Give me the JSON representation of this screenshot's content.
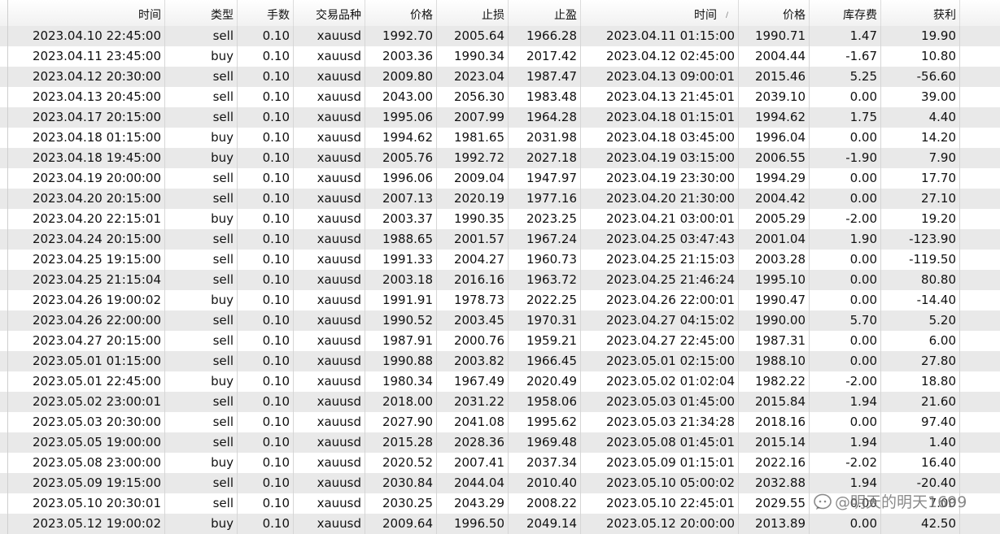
{
  "headers": [
    "时间",
    "类型",
    "手数",
    "交易品种",
    "价格",
    "止损",
    "止盈",
    "时间",
    "价格",
    "库存费",
    "获利"
  ],
  "sort_indicator": "∕",
  "rows": [
    [
      "2023.04.10 22:45:00",
      "sell",
      "0.10",
      "xauusd",
      "1992.70",
      "2005.64",
      "1966.28",
      "2023.04.11 01:15:00",
      "1990.71",
      "1.47",
      "19.90"
    ],
    [
      "2023.04.11 23:45:00",
      "buy",
      "0.10",
      "xauusd",
      "2003.36",
      "1990.34",
      "2017.42",
      "2023.04.12 02:45:00",
      "2004.44",
      "-1.67",
      "10.80"
    ],
    [
      "2023.04.12 20:30:00",
      "sell",
      "0.10",
      "xauusd",
      "2009.80",
      "2023.04",
      "1987.47",
      "2023.04.13 09:00:01",
      "2015.46",
      "5.25",
      "-56.60"
    ],
    [
      "2023.04.13 20:45:00",
      "sell",
      "0.10",
      "xauusd",
      "2043.00",
      "2056.30",
      "1983.48",
      "2023.04.13 21:45:01",
      "2039.10",
      "0.00",
      "39.00"
    ],
    [
      "2023.04.17 20:15:00",
      "sell",
      "0.10",
      "xauusd",
      "1995.06",
      "2007.99",
      "1964.28",
      "2023.04.18 01:15:01",
      "1994.62",
      "1.75",
      "4.40"
    ],
    [
      "2023.04.18 01:15:00",
      "buy",
      "0.10",
      "xauusd",
      "1994.62",
      "1981.65",
      "2031.98",
      "2023.04.18 03:45:00",
      "1996.04",
      "0.00",
      "14.20"
    ],
    [
      "2023.04.18 19:45:00",
      "buy",
      "0.10",
      "xauusd",
      "2005.76",
      "1992.72",
      "2027.18",
      "2023.04.19 03:15:00",
      "2006.55",
      "-1.90",
      "7.90"
    ],
    [
      "2023.04.19 20:00:00",
      "sell",
      "0.10",
      "xauusd",
      "1996.06",
      "2009.04",
      "1947.97",
      "2023.04.19 23:30:00",
      "1994.29",
      "0.00",
      "17.70"
    ],
    [
      "2023.04.20 20:15:00",
      "sell",
      "0.10",
      "xauusd",
      "2007.13",
      "2020.19",
      "1977.16",
      "2023.04.20 21:30:00",
      "2004.42",
      "0.00",
      "27.10"
    ],
    [
      "2023.04.20 22:15:01",
      "buy",
      "0.10",
      "xauusd",
      "2003.37",
      "1990.35",
      "2023.25",
      "2023.04.21 03:00:01",
      "2005.29",
      "-2.00",
      "19.20"
    ],
    [
      "2023.04.24 20:15:00",
      "sell",
      "0.10",
      "xauusd",
      "1988.65",
      "2001.57",
      "1967.24",
      "2023.04.25 03:47:43",
      "2001.04",
      "1.90",
      "-123.90"
    ],
    [
      "2023.04.25 19:15:00",
      "sell",
      "0.10",
      "xauusd",
      "1991.33",
      "2004.27",
      "1960.73",
      "2023.04.25 21:15:03",
      "2003.28",
      "0.00",
      "-119.50"
    ],
    [
      "2023.04.25 21:15:04",
      "sell",
      "0.10",
      "xauusd",
      "2003.18",
      "2016.16",
      "1963.72",
      "2023.04.25 21:46:24",
      "1995.10",
      "0.00",
      "80.80"
    ],
    [
      "2023.04.26 19:00:02",
      "buy",
      "0.10",
      "xauusd",
      "1991.91",
      "1978.73",
      "2022.25",
      "2023.04.26 22:00:01",
      "1990.47",
      "0.00",
      "-14.40"
    ],
    [
      "2023.04.26 22:00:00",
      "sell",
      "0.10",
      "xauusd",
      "1990.52",
      "2003.45",
      "1970.31",
      "2023.04.27 04:15:02",
      "1990.00",
      "5.70",
      "5.20"
    ],
    [
      "2023.04.27 20:15:00",
      "sell",
      "0.10",
      "xauusd",
      "1987.91",
      "2000.76",
      "1959.21",
      "2023.04.27 22:45:00",
      "1987.31",
      "0.00",
      "6.00"
    ],
    [
      "2023.05.01 01:15:00",
      "sell",
      "0.10",
      "xauusd",
      "1990.88",
      "2003.82",
      "1966.45",
      "2023.05.01 02:15:00",
      "1988.10",
      "0.00",
      "27.80"
    ],
    [
      "2023.05.01 22:45:00",
      "buy",
      "0.10",
      "xauusd",
      "1980.34",
      "1967.49",
      "2020.49",
      "2023.05.02 01:02:04",
      "1982.22",
      "-2.00",
      "18.80"
    ],
    [
      "2023.05.02 23:00:01",
      "sell",
      "0.10",
      "xauusd",
      "2018.00",
      "2031.22",
      "1958.06",
      "2023.05.03 01:45:00",
      "2015.84",
      "1.94",
      "21.60"
    ],
    [
      "2023.05.03 20:30:00",
      "sell",
      "0.10",
      "xauusd",
      "2027.90",
      "2041.08",
      "1995.62",
      "2023.05.03 21:34:28",
      "2018.16",
      "0.00",
      "97.40"
    ],
    [
      "2023.05.05 19:00:00",
      "sell",
      "0.10",
      "xauusd",
      "2015.28",
      "2028.36",
      "1969.48",
      "2023.05.08 01:45:01",
      "2015.14",
      "1.94",
      "1.40"
    ],
    [
      "2023.05.08 23:00:00",
      "buy",
      "0.10",
      "xauusd",
      "2020.52",
      "2007.41",
      "2037.34",
      "2023.05.09 01:15:01",
      "2022.16",
      "-2.02",
      "16.40"
    ],
    [
      "2023.05.09 19:15:00",
      "sell",
      "0.10",
      "xauusd",
      "2030.84",
      "2044.04",
      "2010.40",
      "2023.05.10 05:00:02",
      "2032.88",
      "1.94",
      "-20.40"
    ],
    [
      "2023.05.10 20:30:01",
      "sell",
      "0.10",
      "xauusd",
      "2030.25",
      "2043.29",
      "2008.22",
      "2023.05.10 22:45:01",
      "2029.55",
      "0.00",
      "7.00"
    ],
    [
      "2023.05.12 19:00:02",
      "buy",
      "0.10",
      "xauusd",
      "2009.64",
      "1996.50",
      "2049.14",
      "2023.05.12 20:00:00",
      "2013.89",
      "0.00",
      "42.50"
    ]
  ],
  "watermark": {
    "text": "@明天的明天1699",
    "icon": "zhihu-logo-icon"
  }
}
